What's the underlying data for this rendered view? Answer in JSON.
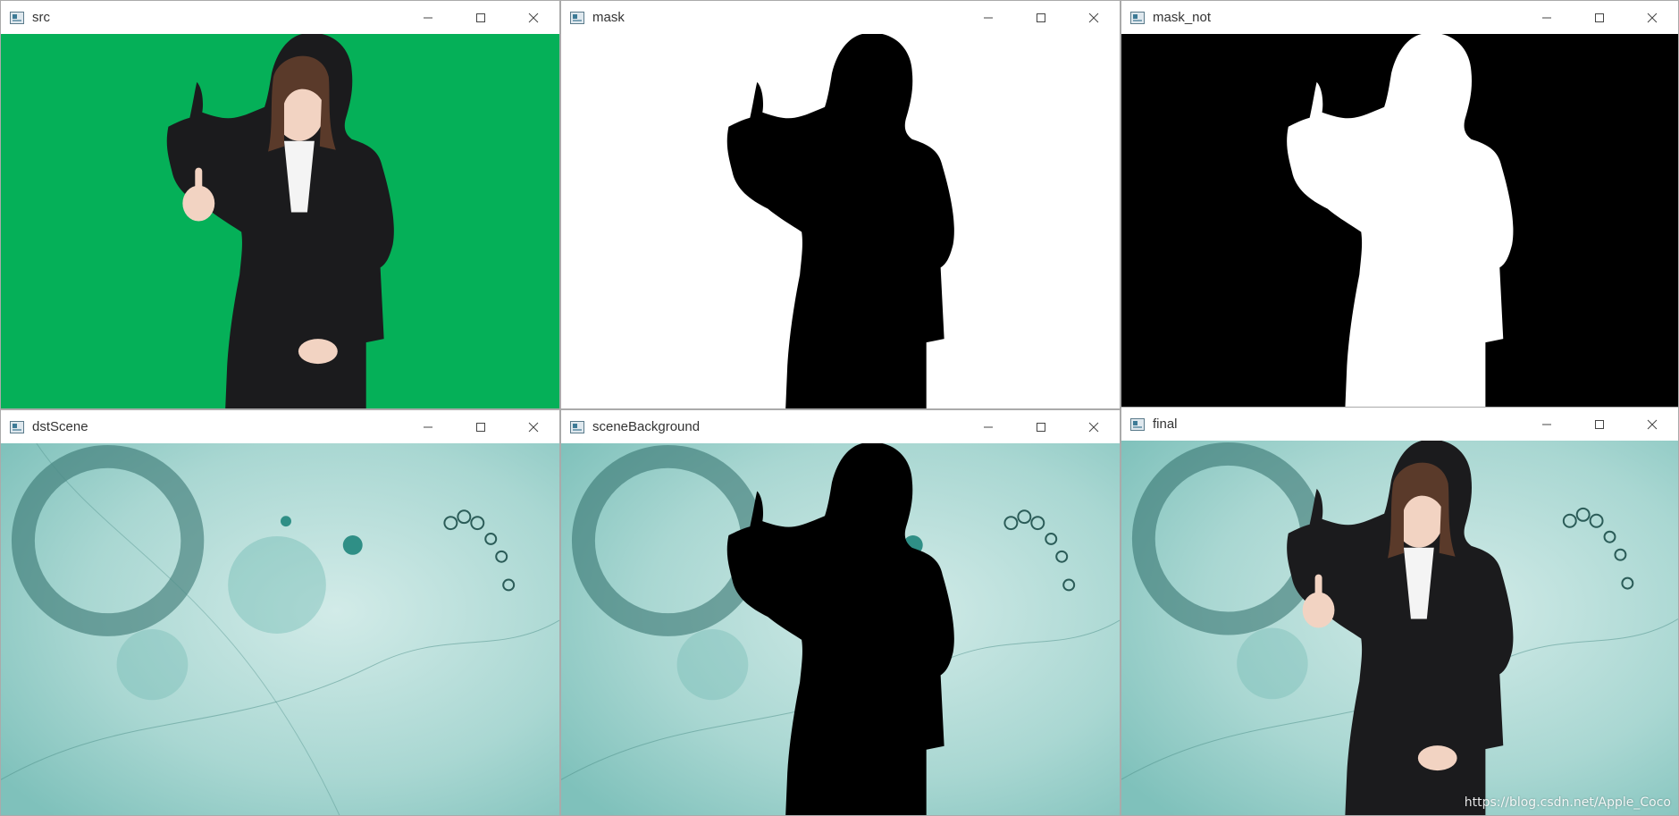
{
  "windows": [
    {
      "title": "src"
    },
    {
      "title": "mask"
    },
    {
      "title": "mask_not"
    },
    {
      "title": "dstScene"
    },
    {
      "title": "sceneBackground"
    },
    {
      "title": "final"
    }
  ],
  "watermark_text": "https://blog.csdn.net/Apple_Coco",
  "colors": {
    "green_screen": "#05b35a",
    "teal_background": "#b8dedb",
    "mask_white": "#ffffff",
    "mask_black": "#000000"
  }
}
